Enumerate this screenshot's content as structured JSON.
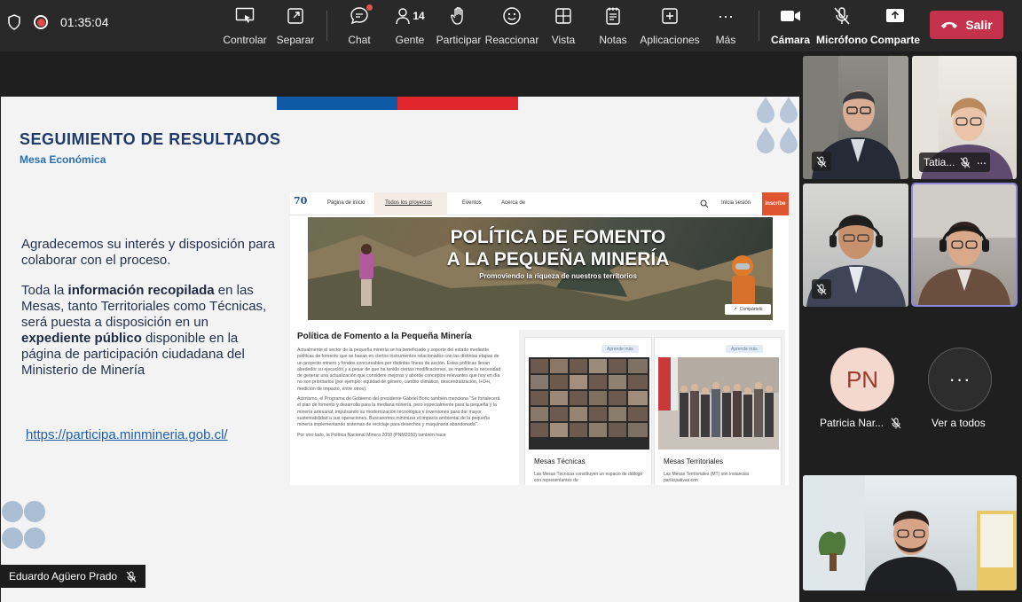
{
  "meeting": {
    "timer": "01:35:04",
    "toolbar": {
      "controlar": "Controlar",
      "separar": "Separar",
      "chat": "Chat",
      "gente": "Gente",
      "gente_count": "14",
      "participar": "Participar",
      "reaccionar": "Reaccionar",
      "vista": "Vista",
      "notas": "Notas",
      "aplicaciones": "Aplicaciones",
      "mas": "Más",
      "camara": "Cámara",
      "microfono": "Micrófono",
      "comparte": "Comparte",
      "salir": "Salir"
    }
  },
  "slide": {
    "title": "SEGUIMIENTO DE RESULTADOS",
    "subtitle": "Mesa Económica",
    "p1": "Agradecemos su interés y disposición para colaborar con el proceso.",
    "p2_a": "Toda la ",
    "p2_b": "información recopilada",
    "p2_c": " en las Mesas, tanto Territoriales como Técnicas, será puesta a disposición en un ",
    "p2_d": "expediente público",
    "p2_e": " disponible en la página de participación ciudadana del Ministerio de Minería",
    "link": "https://participa.minmineria.gob.cl/"
  },
  "site": {
    "logo": "70",
    "nav": [
      "Página de inicio",
      "Todos los proyectos",
      "Eventos",
      "Acerca de"
    ],
    "login": "Inicia sesión",
    "signup": "Inscríbe",
    "banner_title_1": "POLÍTICA DE FOMENTO",
    "banner_title_2": "A LA PEQUEÑA MINERÍA",
    "banner_sub": "Promoviendo la riqueza de nuestros territorios",
    "share": "Compártelo",
    "heading": "Política de Fomento a la Pequeña Minería",
    "paragraph1": "Actualmente el sector de la pequeña minería se ha beneficiado y soporte del estado mediante políticas de fomento que se basan en ciertos instrumentos relacionados con las distintas etapas de un proyecto minero y fondos concursables por distintas líneas de acción. Estas políticas llevan alrededor su ejecución y a pesar de que ha tenido ciertas modificaciones, se mantiene la necesidad de generar una actualización que considere mejoras y aborde conceptos relevantes que hoy en día no son prioritarios (por ejemplo: equidad de género, cambio climático, descentralización, I+D+i, medición de impacto, entre otros).",
    "paragraph2": "Asimismo, el Programa de Gobierno del presidente Gabriel Boric también menciona \"Se fortalecerá el plan de fomento y desarrollo para la mediana minería, pero especialmente para la pequeña y la minería artesanal, impulsando su modernización tecnológica e inversiones para dar mayor sustentabilidad a sus operaciones. Buscaremos minimizar el impacto ambiental de la pequeña minería implementando sistemas de reciclaje para desechos y maquinaria abandonada\".",
    "paragraph3": "Por otro lado, la Política Nacional Minera 2050 (PNM2050) también hace",
    "cards": [
      {
        "pill": "Aprende más",
        "title": "Mesas Técnicas",
        "text": "Las Mesas Técnicas constituyen un espacio de diálogo con representantes de"
      },
      {
        "pill": "Aprende más",
        "title": "Mesas Territoriales",
        "text": "Las Mesas Territoriales (MT) son instancias participativas con"
      }
    ]
  },
  "presenter": "Eduardo Agüero Prado",
  "participants": {
    "tile2_name": "Tatia...",
    "pn_initials": "PN",
    "pn_name": "Patricia Nar...",
    "view_all": "Ver a todos",
    "more_glyph": "···"
  }
}
